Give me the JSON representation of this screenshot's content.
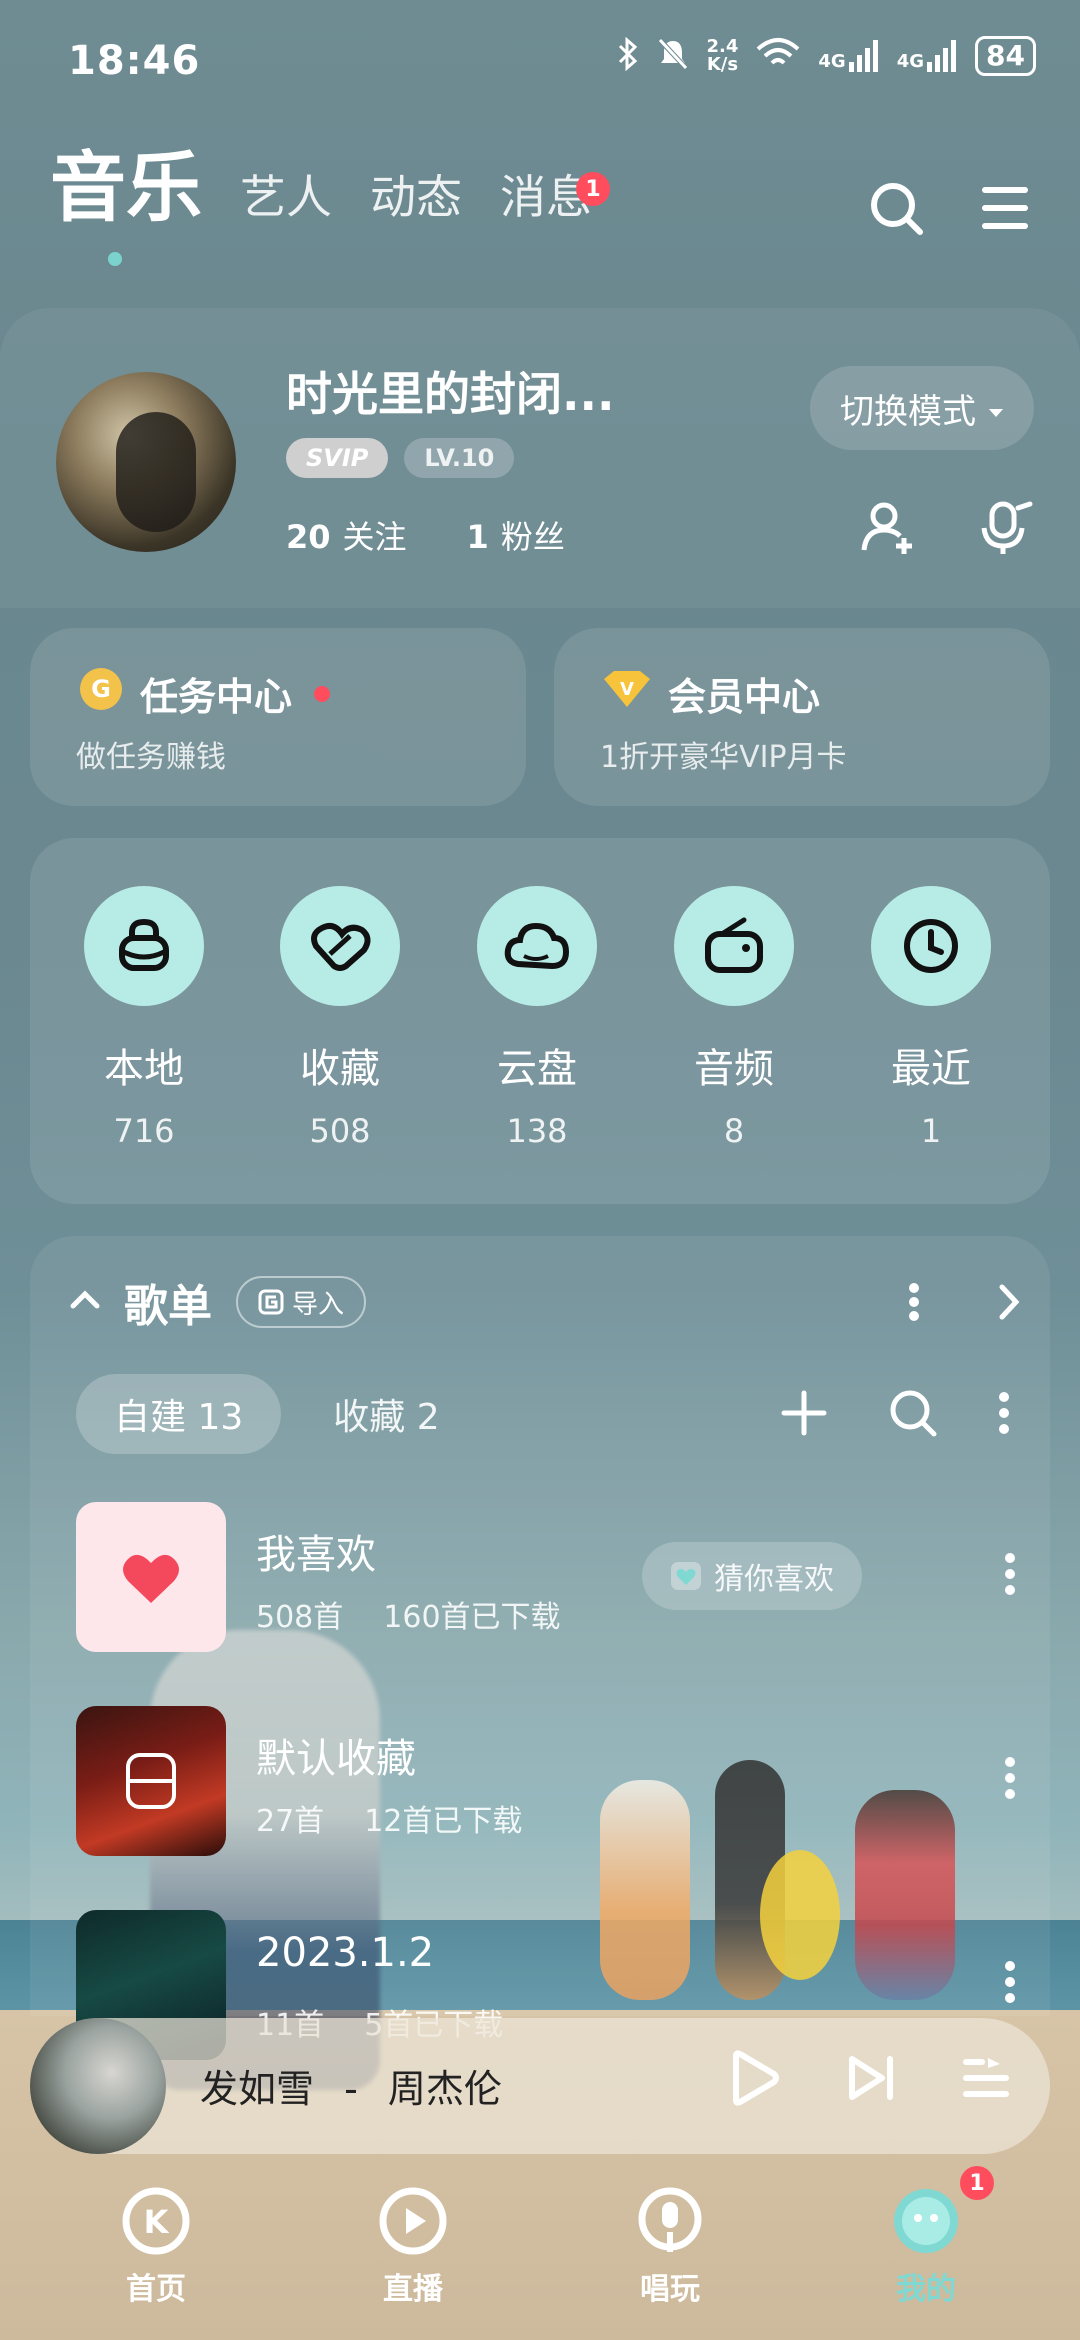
{
  "status": {
    "time": "18:46",
    "net_speed_top": "2.4",
    "net_speed_bottom": "K/s",
    "signal1": "4G",
    "signal2": "4G",
    "battery": "84"
  },
  "header": {
    "tabs": [
      {
        "label": "音乐"
      },
      {
        "label": "艺人"
      },
      {
        "label": "动态"
      },
      {
        "label": "消息",
        "badge": "1"
      }
    ]
  },
  "profile": {
    "name": "时光里的封闭...",
    "svip": "SVIP",
    "level": "LV.10",
    "following_count": "20",
    "following_label": "关注",
    "fans_count": "1",
    "fans_label": "粉丝",
    "switch_mode": "切换模式"
  },
  "task_center": {
    "title": "任务中心",
    "subtitle": "做任务赚钱"
  },
  "vip_center": {
    "title": "会员中心",
    "subtitle": "1折开豪华VIP月卡"
  },
  "quick": [
    {
      "label": "本地",
      "count": "716",
      "icon": "lock-icon"
    },
    {
      "label": "收藏",
      "count": "508",
      "icon": "heart-icon"
    },
    {
      "label": "云盘",
      "count": "138",
      "icon": "cloud-icon"
    },
    {
      "label": "音频",
      "count": "8",
      "icon": "radio-icon"
    },
    {
      "label": "最近",
      "count": "1",
      "icon": "clock-icon"
    }
  ],
  "playlists_section": {
    "title": "歌单",
    "import": "导入",
    "tab_created": "自建 13",
    "tab_saved": "收藏 2",
    "items": [
      {
        "name": "我喜欢",
        "count": "508首",
        "downloaded": "160首已下载",
        "guess": "猜你喜欢"
      },
      {
        "name": "默认收藏",
        "count": "27首",
        "downloaded": "12首已下载"
      },
      {
        "name": "2023.1.2",
        "count": "11首",
        "downloaded": "5首已下载"
      }
    ]
  },
  "player": {
    "song": "发如雪",
    "separator": "-",
    "artist": "周杰伦"
  },
  "nav": {
    "items": [
      {
        "label": "首页"
      },
      {
        "label": "直播"
      },
      {
        "label": "唱玩"
      },
      {
        "label": "我的",
        "badge": "1"
      }
    ]
  },
  "colors": {
    "accent": "#7fd9d2",
    "badge": "#ff4d5e",
    "quick_circle": "#b7ece6"
  }
}
